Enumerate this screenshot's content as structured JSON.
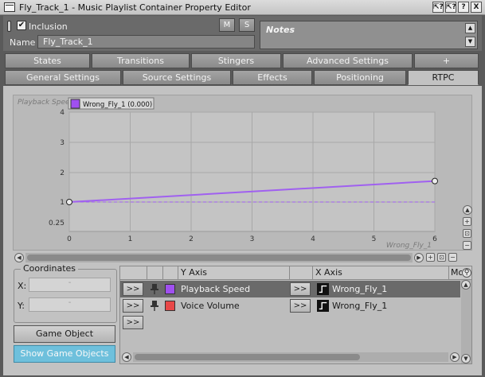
{
  "window": {
    "title": "Fly_Track_1 - Music Playlist Container Property Editor",
    "buttons": [
      "⇱?",
      "⇱?",
      "?",
      "X"
    ]
  },
  "header": {
    "inclusion_label": "Inclusion",
    "inclusion_checked": "✔",
    "name_label": "Name",
    "name_value": "Fly_Track_1",
    "mute_label": "M",
    "solo_label": "S",
    "notes_label": "Notes"
  },
  "tabs_row1": [
    "States",
    "Transitions",
    "Stingers",
    "Advanced Settings",
    "+"
  ],
  "tabs_row2": [
    "General Settings",
    "Source Settings",
    "Effects",
    "Positioning",
    "RTPC"
  ],
  "active_tab": "RTPC",
  "graph": {
    "legend_label": "Wrong_Fly_1 (0.000)",
    "y_axis_title": "Playback Speed",
    "x_axis_title": "Wrong_Fly_1"
  },
  "chart_data": {
    "type": "line",
    "xlabel": "Wrong_Fly_1",
    "ylabel": "Playback Speed",
    "x_ticks": [
      "0",
      "1",
      "2",
      "3",
      "4",
      "5",
      "6"
    ],
    "y_ticks": [
      "4",
      "3",
      "2",
      "1",
      "0.25"
    ],
    "xlim": [
      0,
      6
    ],
    "series": [
      {
        "name": "Wrong_Fly_1",
        "color": "#a060f0",
        "x": [
          0,
          6
        ],
        "y": [
          1,
          1.7
        ]
      }
    ],
    "baseline": 1,
    "grid": true
  },
  "coordinates": {
    "title": "Coordinates",
    "x_label": "X:",
    "y_label": "Y:",
    "x_value": "-",
    "y_value": "-"
  },
  "buttons": {
    "explorer": "Game Object Explorer...",
    "show_objects": "Show Game Objects"
  },
  "table": {
    "headers": {
      "y_axis": "Y Axis",
      "x_axis": "X Axis",
      "mo": "Mo"
    },
    "rows": [
      {
        "arrow": ">>",
        "y_axis": "Playback Speed",
        "y_color": "#a050f0",
        "x_arrow": ">>",
        "x_axis": "Wrong_Fly_1",
        "selected": true
      },
      {
        "arrow": ">>",
        "y_axis": "Voice Volume",
        "y_color": "#e84848",
        "x_arrow": ">>",
        "x_axis": "Wrong_Fly_1",
        "selected": false
      },
      {
        "arrow": ">>"
      }
    ]
  },
  "colors": {
    "accent_button": "#6ec0dc",
    "curve": "#a060f0"
  }
}
